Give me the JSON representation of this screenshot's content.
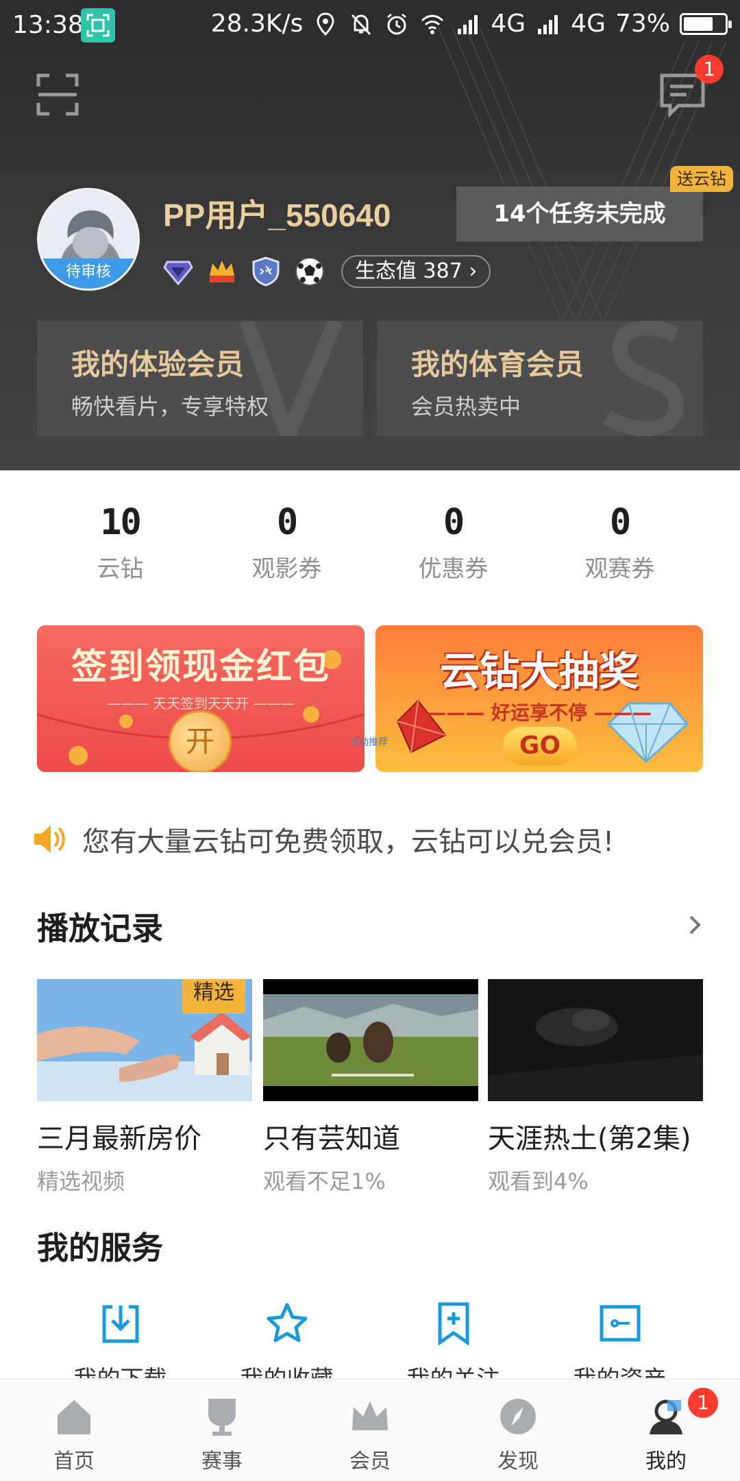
{
  "status_bar": {
    "time": "13:38",
    "network_speed": "28.3K/s",
    "signal1": "4G",
    "signal2": "4G",
    "battery": "73%",
    "battery_level": 0.73
  },
  "header": {
    "message_count": "1",
    "username": "PP用户_550640",
    "avatar_tag": "待审核",
    "eco_label": "生态值 387 ›",
    "task_button": "14个任务未完成",
    "gift_tag": "送云钻",
    "badges": [
      "diamond-badge-icon",
      "crown-badge-icon",
      "shield-badge-icon",
      "football-badge-icon"
    ]
  },
  "vip_cards": [
    {
      "title": "我的体验会员",
      "subtitle": "畅快看片，专享特权"
    },
    {
      "title": "我的体育会员",
      "subtitle": "会员热卖中"
    }
  ],
  "stats": [
    {
      "value": "10",
      "label": "云钻"
    },
    {
      "value": "0",
      "label": "观影券"
    },
    {
      "value": "0",
      "label": "优惠券"
    },
    {
      "value": "0",
      "label": "观赛券"
    }
  ],
  "banners": {
    "left": {
      "title": "签到领现金红包",
      "subtitle": "——— 天天签到天天开 ———",
      "coin": "开"
    },
    "right": {
      "title": "云钻大抽奖",
      "subtitle": "——— 好运享不停 ———",
      "go": "GO"
    },
    "caption": "活动推荐"
  },
  "notice": {
    "text": "您有大量云钻可免费领取，云钻可以兑会员!"
  },
  "history": {
    "title": "播放记录",
    "items": [
      {
        "title": "三月最新房价",
        "subtitle": "精选视频",
        "tag": "精选"
      },
      {
        "title": "只有芸知道",
        "subtitle": "观看不足1%"
      },
      {
        "title": "天涯热土(第2集)",
        "subtitle": "观看到4%"
      }
    ]
  },
  "services": {
    "title": "我的服务",
    "items": [
      {
        "label": "我的下载",
        "icon": "download-icon"
      },
      {
        "label": "我的收藏",
        "icon": "star-icon"
      },
      {
        "label": "我的关注",
        "icon": "bookmark-icon"
      },
      {
        "label": "我的资产",
        "icon": "ticket-icon"
      }
    ]
  },
  "bottom_nav": {
    "items": [
      {
        "label": "首页",
        "icon": "home-icon"
      },
      {
        "label": "赛事",
        "icon": "trophy-icon"
      },
      {
        "label": "会员",
        "icon": "crown-icon"
      },
      {
        "label": "发现",
        "icon": "compass-icon"
      },
      {
        "label": "我的",
        "icon": "profile-icon"
      }
    ],
    "profile_badge": "1"
  },
  "colors": {
    "header_bg": "#3a3a3c",
    "gold_text": "#e8cf9e",
    "accent_blue": "#1a9ad9",
    "badge_red": "#ff3b30",
    "tag_yellow": "#f2b43c"
  }
}
